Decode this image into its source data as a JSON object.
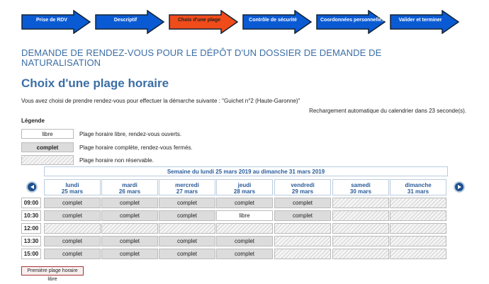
{
  "steps": [
    "Prise de RDV",
    "Descriptif",
    "Choix d'une plage",
    "Contrôle de sécurité",
    "Coordonnées personnelles",
    "Valider et terminer"
  ],
  "active_step": 2,
  "colors": {
    "step": "#0a5ad4",
    "step_active": "#f04b1a",
    "heading": "#3b6ea5"
  },
  "title": "DEMANDE DE RENDEZ-VOUS POUR LE DÉPÔT D'UN DOSSIER DE DEMANDE DE NATURALISATION",
  "subtitle": "Choix d'une plage horaire",
  "intro": "Vous avez choisi de prendre rendez-vous pour effectuer la démarche suivante : \"Guichet n°2 (Haute-Garonne)\"",
  "reload": "Rechargement automatique du calendrier dans 23   seconde(s).",
  "legend": {
    "title": "Légende",
    "items": [
      {
        "box": "libre",
        "text": "Plage horaire libre, rendez-vous ouverts."
      },
      {
        "box": "complet",
        "text": "Plage horaire complète, rendez-vous fermés."
      },
      {
        "box": "",
        "text": "Plage horaire non réservable."
      }
    ]
  },
  "week_label": "Semaine du lundi 25 mars 2019 au dimanche 31 mars 2019",
  "days": [
    {
      "name": "lundi",
      "date": "25 mars"
    },
    {
      "name": "mardi",
      "date": "26 mars"
    },
    {
      "name": "mercredi",
      "date": "27 mars"
    },
    {
      "name": "jeudi",
      "date": "28 mars"
    },
    {
      "name": "vendredi",
      "date": "29 mars"
    },
    {
      "name": "samedi",
      "date": "30 mars"
    },
    {
      "name": "dimanche",
      "date": "31 mars"
    }
  ],
  "rows": [
    {
      "time": "09:00",
      "cells": [
        "complet",
        "complet",
        "complet",
        "complet",
        "complet",
        "",
        ""
      ]
    },
    {
      "time": "10:30",
      "cells": [
        "complet",
        "complet",
        "complet",
        "libre",
        "complet",
        "",
        ""
      ]
    },
    {
      "time": "12:00",
      "cells": [
        "",
        "",
        "",
        "",
        "",
        "",
        ""
      ]
    },
    {
      "time": "13:30",
      "cells": [
        "complet",
        "complet",
        "complet",
        "complet",
        "",
        "",
        ""
      ]
    },
    {
      "time": "15:00",
      "cells": [
        "complet",
        "complet",
        "complet",
        "complet",
        "",
        "",
        ""
      ]
    }
  ],
  "first_slot_button": "Première plage horaire libre"
}
